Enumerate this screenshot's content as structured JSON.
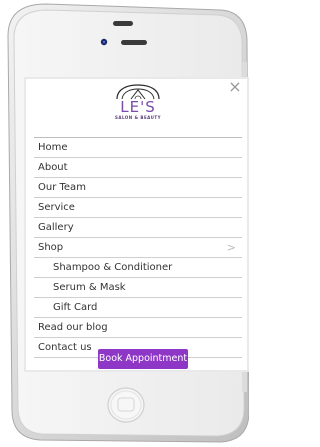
{
  "brand": {
    "name": "LE'S",
    "tagline": "SALON & BEAUTY"
  },
  "icons": {
    "close": "×",
    "chevron": ">"
  },
  "menu": [
    {
      "label": "Home",
      "sub": false
    },
    {
      "label": "About",
      "sub": false
    },
    {
      "label": "Our Team",
      "sub": false
    },
    {
      "label": "Service",
      "sub": false
    },
    {
      "label": "Gallery",
      "sub": false
    },
    {
      "label": "Shop",
      "sub": false,
      "expandable": true
    },
    {
      "label": "Shampoo & Conditioner",
      "sub": true
    },
    {
      "label": "Serum & Mask",
      "sub": true
    },
    {
      "label": "Gift Card",
      "sub": true
    },
    {
      "label": "Read our blog",
      "sub": false
    },
    {
      "label": "Contact us",
      "sub": false
    }
  ],
  "cta": {
    "label": "Book Appointment"
  },
  "colors": {
    "accent": "#8e37c7",
    "brand": "#7a4ca8"
  }
}
